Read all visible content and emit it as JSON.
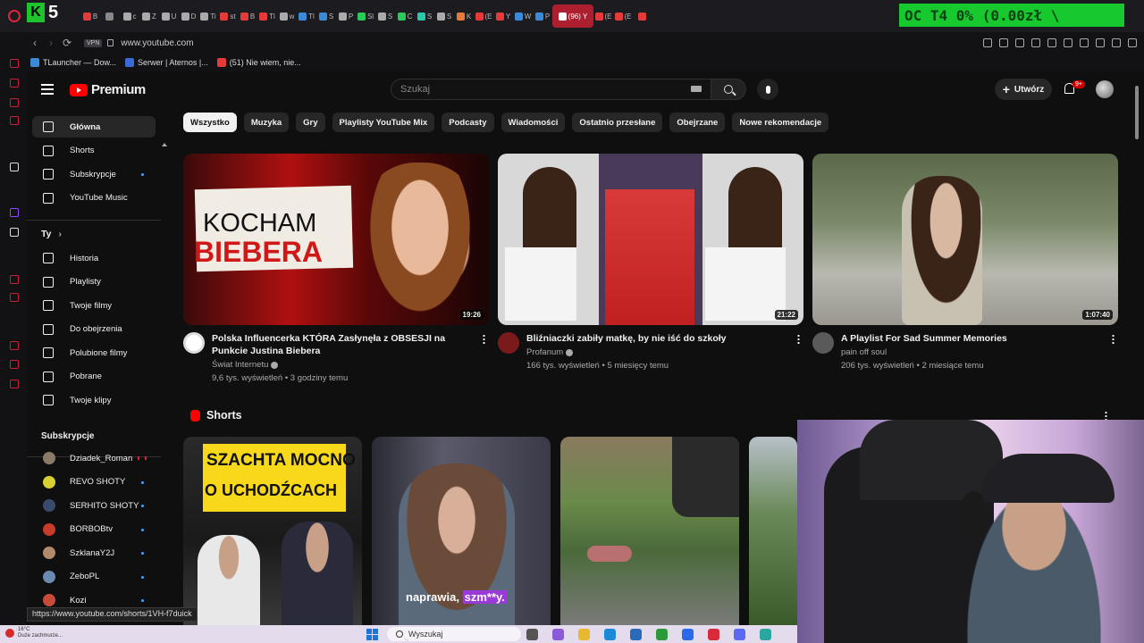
{
  "browser": {
    "stream_letter": "K",
    "stream_count": "5",
    "overlay_banner": "OC T4 0% (0.00zł \\",
    "active_tab_label": "(96) Y",
    "tabs": [
      {
        "label": "B",
        "color": "#e63a3a"
      },
      {
        "label": "",
        "color": "#888888"
      },
      {
        "label": "c",
        "color": "#aaaaaa"
      },
      {
        "label": "Z",
        "color": "#aaaaaa"
      },
      {
        "label": "U",
        "color": "#aaaaaa"
      },
      {
        "label": "D",
        "color": "#aaaaaa"
      },
      {
        "label": "Ti",
        "color": "#aaaaaa"
      },
      {
        "label": "st",
        "color": "#e63a3a"
      },
      {
        "label": "B",
        "color": "#e63a3a"
      },
      {
        "label": "Tl",
        "color": "#e63a3a"
      },
      {
        "label": "w",
        "color": "#aaaaaa"
      },
      {
        "label": "Tl",
        "color": "#3a8ad8"
      },
      {
        "label": "S",
        "color": "#3a8ad8"
      },
      {
        "label": "P",
        "color": "#aaaaaa"
      },
      {
        "label": "Sl",
        "color": "#2ac95a"
      },
      {
        "label": "S",
        "color": "#aaaaaa"
      },
      {
        "label": "C",
        "color": "#2ac95a"
      },
      {
        "label": "S",
        "color": "#2ac9a9"
      },
      {
        "label": "S",
        "color": "#aaaaaa"
      },
      {
        "label": "K",
        "color": "#e67a3a"
      },
      {
        "label": "(E",
        "color": "#e63a3a"
      },
      {
        "label": "Y",
        "color": "#e63a3a"
      },
      {
        "label": "W",
        "color": "#3a8ad8"
      },
      {
        "label": "P",
        "color": "#3a8ad8"
      }
    ],
    "tabs_after": [
      {
        "label": "(E",
        "color": "#e63a3a"
      },
      {
        "label": "(E",
        "color": "#e63a3a"
      },
      {
        "label": "",
        "color": "#e63a3a"
      }
    ],
    "vpn_label": "VPN",
    "url": "www.youtube.com",
    "bookmarks": [
      {
        "label": "TLauncher — Dow...",
        "color": "#3a8ad8"
      },
      {
        "label": "Serwer | Aternos |...",
        "color": "#3a6ad8"
      },
      {
        "label": "(51) Nie wiem, nie...",
        "color": "#e63a3a"
      }
    ],
    "status_url": "https://www.youtube.com/shorts/1VH-f7duick"
  },
  "youtube": {
    "logo_text": "Premium",
    "search_placeholder": "Szukaj",
    "create_label": "Utwórz",
    "notification_count": "9+",
    "sidebar_main": [
      {
        "label": "Główna",
        "icon": "home-icon",
        "active": true,
        "dot": false
      },
      {
        "label": "Shorts",
        "icon": "shorts-icon",
        "active": false,
        "dot": false
      },
      {
        "label": "Subskrypcje",
        "icon": "subscriptions-icon",
        "active": false,
        "dot": true
      },
      {
        "label": "YouTube Music",
        "icon": "music-icon",
        "active": false,
        "dot": false
      }
    ],
    "you_heading": "Ty",
    "sidebar_you": [
      {
        "label": "Historia",
        "icon": "history-icon"
      },
      {
        "label": "Playlisty",
        "icon": "playlists-icon"
      },
      {
        "label": "Twoje filmy",
        "icon": "your-videos-icon"
      },
      {
        "label": "Do obejrzenia",
        "icon": "watch-later-icon"
      },
      {
        "label": "Polubione filmy",
        "icon": "liked-icon"
      },
      {
        "label": "Pobrane",
        "icon": "download-icon"
      },
      {
        "label": "Twoje klipy",
        "icon": "clips-icon"
      }
    ],
    "subs_heading": "Subskrypcje",
    "subscriptions": [
      {
        "name": "Dziadek_Roman",
        "color": "#8a7a6a",
        "live": true
      },
      {
        "name": "REVO SHOTY",
        "color": "#d8d030",
        "live": false
      },
      {
        "name": "SERHITO SHOTY",
        "color": "#3a4a6a",
        "live": false
      },
      {
        "name": "BORBOBtv",
        "color": "#c83a2a",
        "live": false
      },
      {
        "name": "SzklanaY2J",
        "color": "#b08a6a",
        "live": false
      },
      {
        "name": "ZeboPL",
        "color": "#6a8ab0",
        "live": false
      },
      {
        "name": "Kozi",
        "color": "#c84a3a",
        "live": false
      }
    ],
    "chips": [
      "Wszystko",
      "Muzyka",
      "Gry",
      "Playlisty YouTube Mix",
      "Podcasty",
      "Wiadomości",
      "Ostatnio przesłane",
      "Obejrzane",
      "Nowe rekomendacje"
    ],
    "videos": [
      {
        "title": "Polska Influencerka KTÓRA Zasłynęła z OBSESJI na Punkcie Justina Biebera",
        "channel": "Świat Internetu",
        "meta": "9,6 tys. wyświetleń • 3 godziny temu",
        "duration": "19:26",
        "thumb_text_1": "KOCHAM",
        "thumb_text_2": "BIEBERA",
        "avatar_color": "#ffffff"
      },
      {
        "title": "Bliźniaczki zabiły matkę, by nie iść do szkoły",
        "channel": "Profanum",
        "meta": "166 tys. wyświetleń • 5 miesięcy temu",
        "duration": "21:22",
        "avatar_color": "#7a1a1a"
      },
      {
        "title": "A Playlist For Sad Summer Memories",
        "channel": "pain off soul",
        "meta": "206 tys. wyświetleń • 2 miesiące temu",
        "duration": "1:07:40",
        "avatar_color": "#5a5a5a"
      }
    ],
    "shorts_heading": "Shorts",
    "shorts": [
      {
        "caption_1": "SZACHTA MOCNO",
        "caption_2": "O UCHODŹCACH"
      },
      {
        "caption_plain": "naprawia,",
        "caption_hl": "szm**y."
      },
      {},
      {}
    ]
  },
  "taskbar": {
    "weather_temp": "16°C",
    "weather_desc": "Duże zachmurze...",
    "search_label": "Wyszukaj",
    "apps": [
      {
        "name": "copilot-icon",
        "color": "#8a5ad8"
      },
      {
        "name": "explorer-icon",
        "color": "#e8b830"
      },
      {
        "name": "edge-icon",
        "color": "#1a8ad8"
      },
      {
        "name": "store-icon",
        "color": "#2a6ab8"
      },
      {
        "name": "xbox-icon",
        "color": "#2a9a3a"
      },
      {
        "name": "app-icon",
        "color": "#2a6ae8"
      },
      {
        "name": "opera-icon",
        "color": "#d82a3a"
      },
      {
        "name": "discord-icon",
        "color": "#5a6af0"
      },
      {
        "name": "game-icon",
        "color": "#2aa8a0"
      }
    ]
  }
}
